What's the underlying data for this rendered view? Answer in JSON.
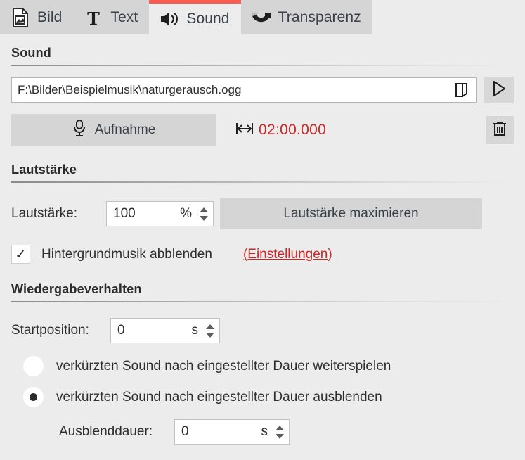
{
  "tabs": [
    {
      "label": "Bild",
      "icon": "image-file-icon",
      "active": false
    },
    {
      "label": "Text",
      "icon": "text-t-icon",
      "active": false
    },
    {
      "label": "Sound",
      "icon": "speaker-icon",
      "active": true
    },
    {
      "label": "Transparenz",
      "icon": "transparency-icon",
      "active": false
    }
  ],
  "sound_section": {
    "heading": "Sound",
    "path_value": "F:\\Bilder\\Beispielmusik\\naturgerausch.ogg",
    "path_placeholder": "",
    "browse_icon": "folder-open-icon",
    "play_icon": "play-icon",
    "record_label": "Aufnahme",
    "record_icon": "microphone-icon",
    "duration_icon": "duration-arrows-icon",
    "duration_value": "02:00.000",
    "delete_icon": "trash-icon"
  },
  "volume_section": {
    "heading": "Lautstärke",
    "field_label": "Lautstärke:",
    "value": "100",
    "unit": "%",
    "maximize_label": "Lautstärke maximieren",
    "checkbox_checked": true,
    "check_glyph": "✓",
    "checkbox_label": "Hintergrundmusik abblenden",
    "settings_link": "(Einstellungen)"
  },
  "playback_section": {
    "heading": "Wiedergabeverhalten",
    "start_label": "Startposition:",
    "start_value": "0",
    "start_unit": "s",
    "radio_continue": "verkürzten Sound nach eingestellter Dauer weiterspielen",
    "radio_fadeout": "verkürzten Sound nach eingestellter Dauer ausblenden",
    "selected_radio": "fadeout",
    "fade_label": "Ausblenddauer:",
    "fade_value": "0",
    "fade_unit": "s"
  },
  "colors": {
    "accent_red": "#fa5c4f",
    "text_red": "#cc2727",
    "page_bg": "#ececec",
    "tab_inactive_bg": "#d5d5d5",
    "button_bg": "#d5d5d5"
  }
}
